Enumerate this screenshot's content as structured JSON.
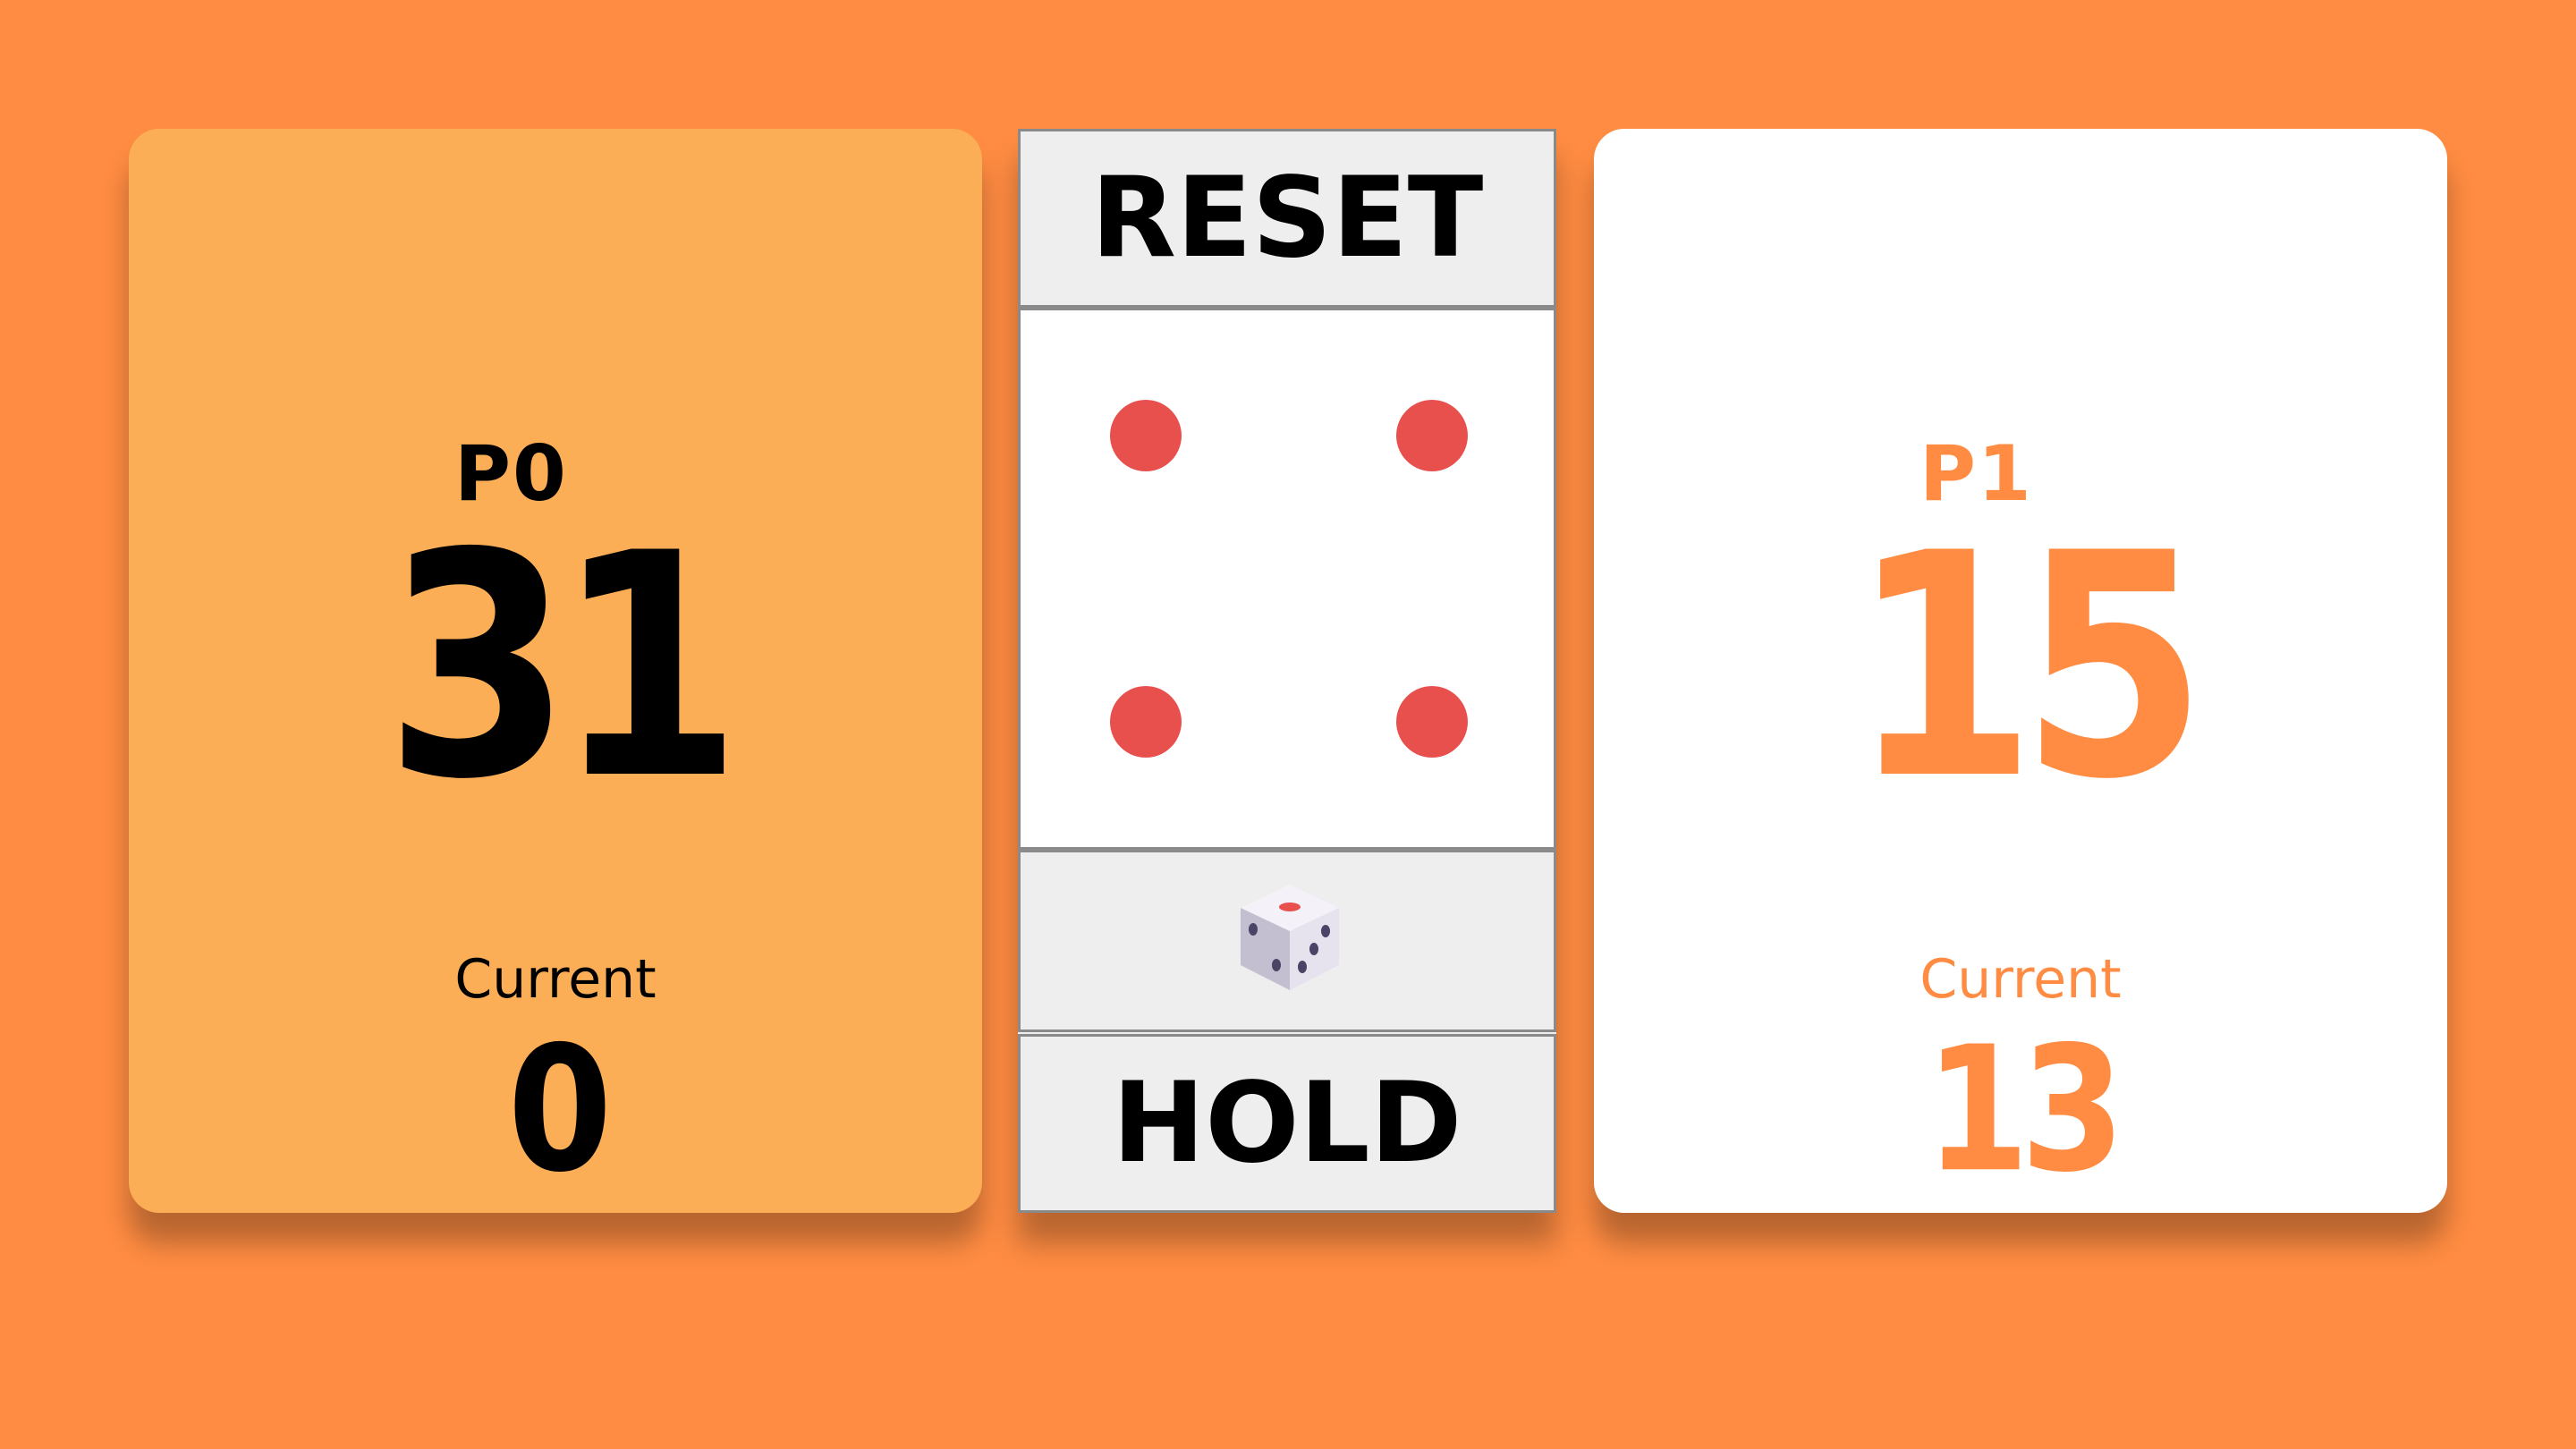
{
  "players": [
    {
      "name": "P0",
      "score": "31",
      "current_label": "Current",
      "current": "0",
      "active": true
    },
    {
      "name": "P1",
      "score": "15",
      "current_label": "Current",
      "current": "13",
      "active": false
    }
  ],
  "controls": {
    "reset_label": "RESET",
    "hold_label": "HOLD",
    "roll_icon": "dice-icon"
  },
  "dice": {
    "value": 4
  },
  "colors": {
    "background": "#ff8c42",
    "active_panel": "#fbae56",
    "inactive_panel": "#ffffff",
    "pip": "#e8504e",
    "button": "#eeeeee"
  }
}
